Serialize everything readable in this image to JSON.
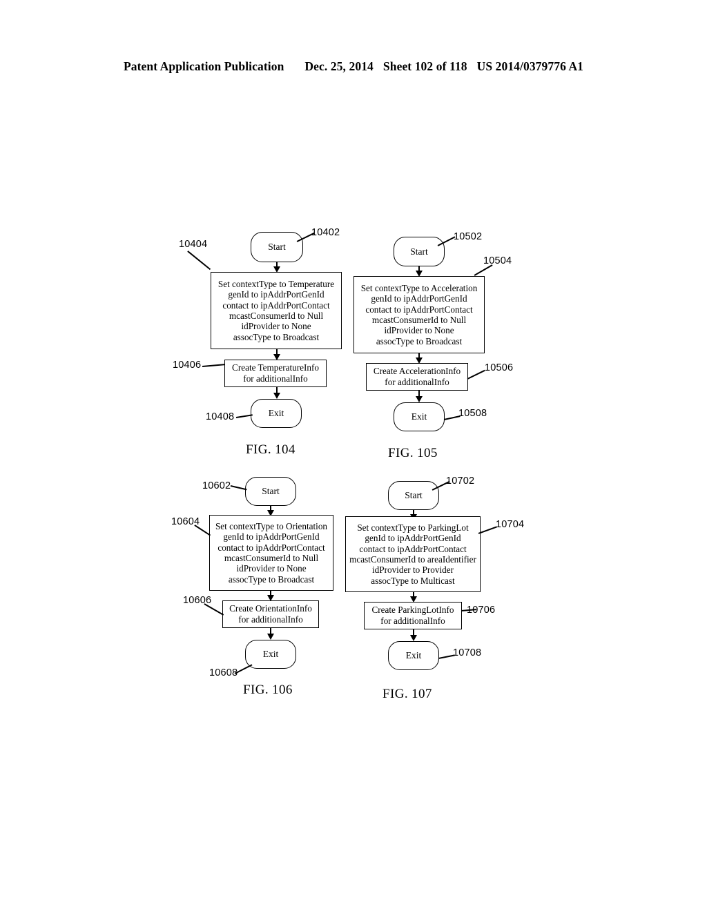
{
  "header": {
    "left": "Patent Application Publication",
    "date": "Dec. 25, 2014",
    "sheet": "Sheet 102 of 118",
    "docnum": "US 2014/0379776 A1"
  },
  "figures": [
    {
      "caption": "FIG. 104",
      "nodes": {
        "start": {
          "label": "Start",
          "ref": "10402"
        },
        "setup": {
          "ref": "10404",
          "lines": "Set contextType to Temperature\ngenId to ipAddrPortGenId\ncontact to ipAddrPortContact\nmcastConsumerId to Null\nidProvider to None\nassocType to Broadcast"
        },
        "create": {
          "ref": "10406",
          "lines": "Create TemperatureInfo\nfor additionalInfo"
        },
        "exit": {
          "label": "Exit",
          "ref": "10408"
        }
      }
    },
    {
      "caption": "FIG. 105",
      "nodes": {
        "start": {
          "label": "Start",
          "ref": "10502"
        },
        "setup": {
          "ref": "10504",
          "lines": "Set contextType to Acceleration\ngenId to ipAddrPortGenId\ncontact to ipAddrPortContact\nmcastConsumerId to Null\nidProvider to None\nassocType to Broadcast"
        },
        "create": {
          "ref": "10506",
          "lines": "Create AccelerationInfo\nfor additionalInfo"
        },
        "exit": {
          "label": "Exit",
          "ref": "10508"
        }
      }
    },
    {
      "caption": "FIG. 106",
      "nodes": {
        "start": {
          "label": "Start",
          "ref": "10602"
        },
        "setup": {
          "ref": "10604",
          "lines": "Set contextType to Orientation\ngenId to ipAddrPortGenId\ncontact to ipAddrPortContact\nmcastConsumerId to Null\nidProvider to None\nassocType to Broadcast"
        },
        "create": {
          "ref": "10606",
          "lines": "Create OrientationInfo\nfor additionalInfo"
        },
        "exit": {
          "label": "Exit",
          "ref": "10608"
        }
      }
    },
    {
      "caption": "FIG. 107",
      "nodes": {
        "start": {
          "label": "Start",
          "ref": "10702"
        },
        "setup": {
          "ref": "10704",
          "lines": "Set contextType to ParkingLot\ngenId to ipAddrPortGenId\ncontact to ipAddrPortContact\nmcastConsumerId to areaIdentifier\nidProvider to Provider\nassocType to Multicast"
        },
        "create": {
          "ref": "10706",
          "lines": "Create ParkingLotInfo\nfor additionalInfo"
        },
        "exit": {
          "label": "Exit",
          "ref": "10708"
        }
      }
    }
  ]
}
